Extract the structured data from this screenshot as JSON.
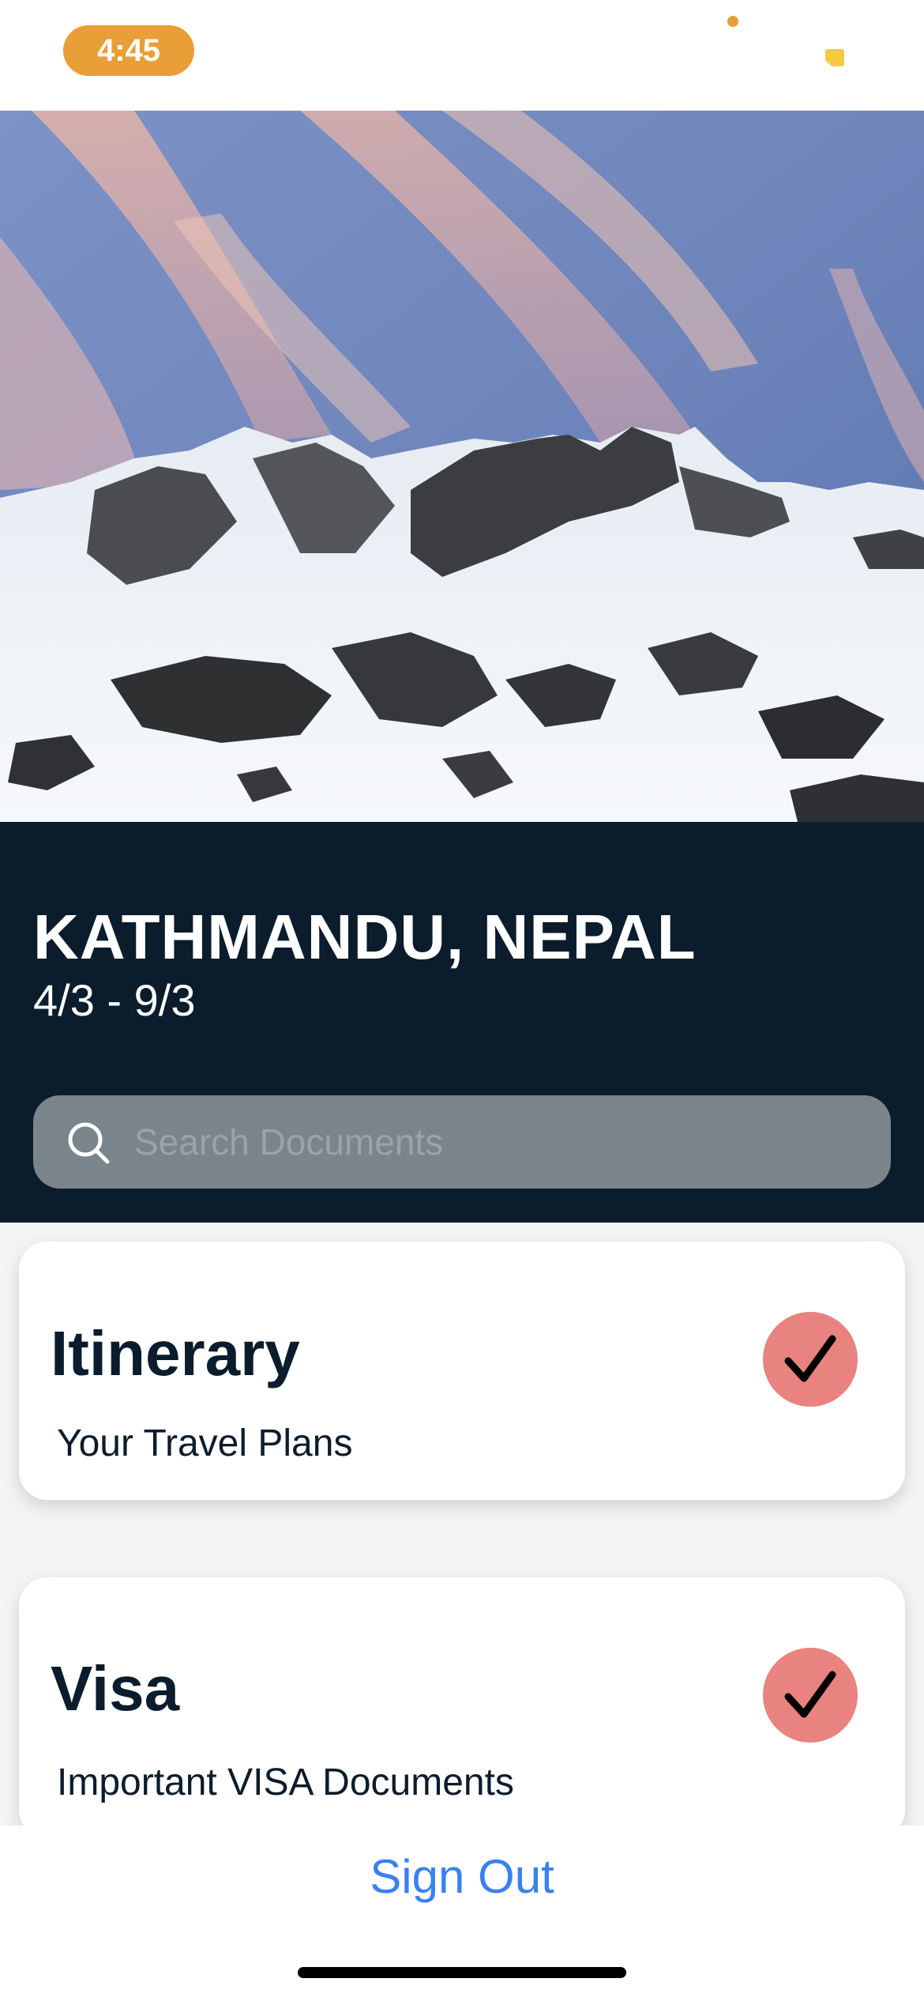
{
  "status_bar": {
    "time": "4:45",
    "time_pill_color": "#e99e37",
    "battery_icon": "battery-low-icon"
  },
  "hero": {
    "image": "snowy-mountain-photo"
  },
  "trip": {
    "destination": "KATHMANDU, NEPAL",
    "dates": "4/3 - 9/3"
  },
  "search": {
    "placeholder": "Search Documents",
    "value": "",
    "icon": "search-icon"
  },
  "cards": [
    {
      "title": "Itinerary",
      "subtitle": "Your Travel Plans",
      "status_icon": "checkmark-icon"
    },
    {
      "title": "Visa",
      "subtitle": "Important VISA Documents",
      "status_icon": "checkmark-icon"
    }
  ],
  "footer": {
    "sign_out_label": "Sign Out"
  },
  "colors": {
    "header_background": "#0b1c2c",
    "badge": "#e8837f",
    "link": "#3a81f0",
    "search_background": "#7a848b"
  }
}
